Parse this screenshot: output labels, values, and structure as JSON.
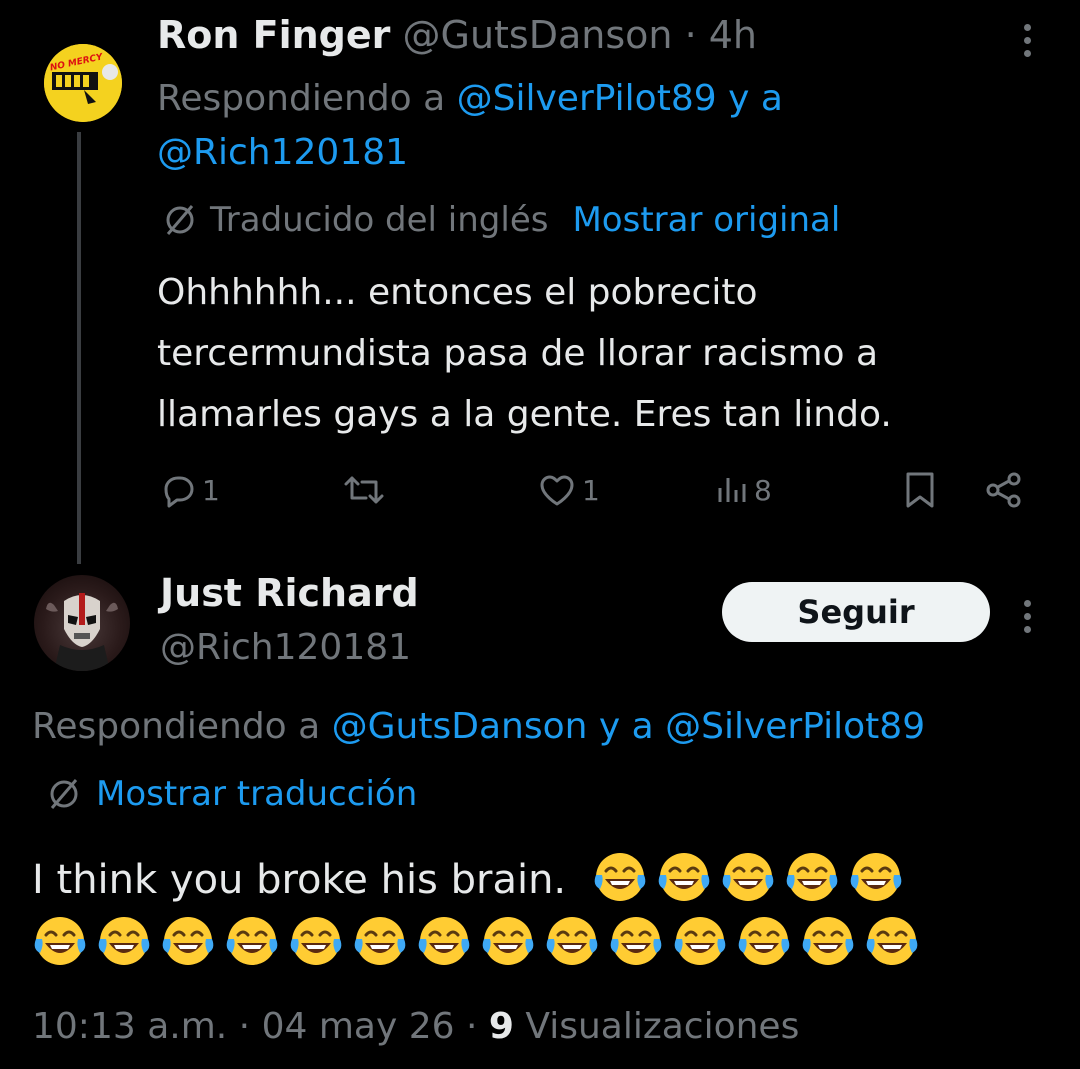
{
  "tweet1": {
    "name": "Ron Finger",
    "handle": "@GutsDanson",
    "sep": " · ",
    "time": "4h",
    "avatar_text": "NO MERCY",
    "replying_prefix": "Respondiendo a ",
    "replying_user1": "@SilverPilot89",
    "replying_and": " y a",
    "replying_user2": "@Rich120181",
    "translated_label": "Traducido del inglés",
    "show_original": "Mostrar original",
    "body": "Ohhhhhh... entonces el pobrecito tercermundista pasa de llorar racismo a llamarles gays a la gente. Eres tan lindo.",
    "actions": {
      "replies": "1",
      "retweets": "",
      "likes": "1",
      "views": "8"
    }
  },
  "tweet2": {
    "name": "Just Richard",
    "handle": "@Rich120181",
    "follow_label": "Seguir",
    "replying_prefix": "Respondiendo a ",
    "replying_user1": "@GutsDanson",
    "replying_and": " y a ",
    "replying_user2": "@SilverPilot89",
    "show_translation": "Mostrar traducción",
    "body_text": "I think you broke his brain.",
    "emoji": "😂",
    "emoji_count_line1": 5,
    "emoji_count_line2": 14,
    "time": "10:13 a.m.",
    "date": "04 may 26",
    "views_count": "9",
    "views_label": "Visualizaciones"
  },
  "colors": {
    "background": "#000000",
    "text": "#e7e9ea",
    "muted": "#71767b",
    "link": "#1d9bf0",
    "follow_bg": "#eff3f4"
  }
}
